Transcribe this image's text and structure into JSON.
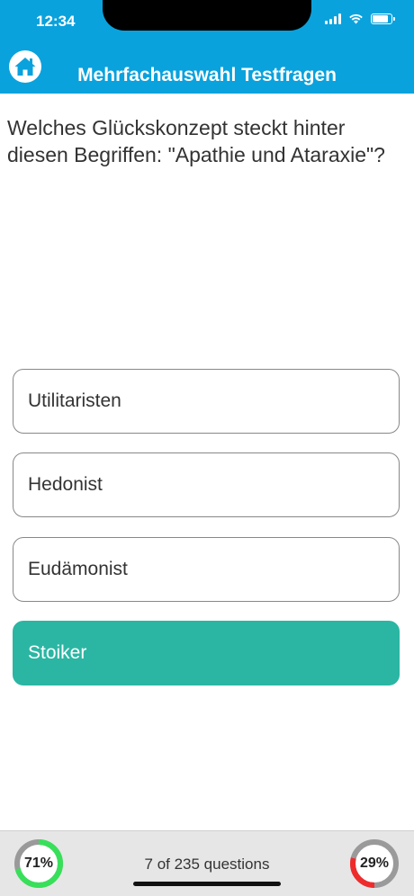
{
  "status_bar": {
    "time": "12:34"
  },
  "header": {
    "title": "Mehrfachauswahl Testfragen",
    "home_icon": "home-icon",
    "color": "#0aa2dd"
  },
  "question": {
    "text": "Welches Glückskonzept steckt hinter diesen Begriffen: \"Apathie und Ataraxie\"?"
  },
  "answers": [
    {
      "label": "Utilitaristen",
      "selected": false
    },
    {
      "label": "Hedonist",
      "selected": false
    },
    {
      "label": "Eudämonist",
      "selected": false
    },
    {
      "label": "Stoiker",
      "selected": true
    }
  ],
  "selected_color": "#2bb6a3",
  "footer": {
    "correct": {
      "label": "71%",
      "value": 0.71,
      "color": "#38e05a"
    },
    "progress": "7 of 235 questions",
    "wrong": {
      "label": "29%",
      "value": 0.29,
      "color": "#ee2c2c"
    }
  }
}
